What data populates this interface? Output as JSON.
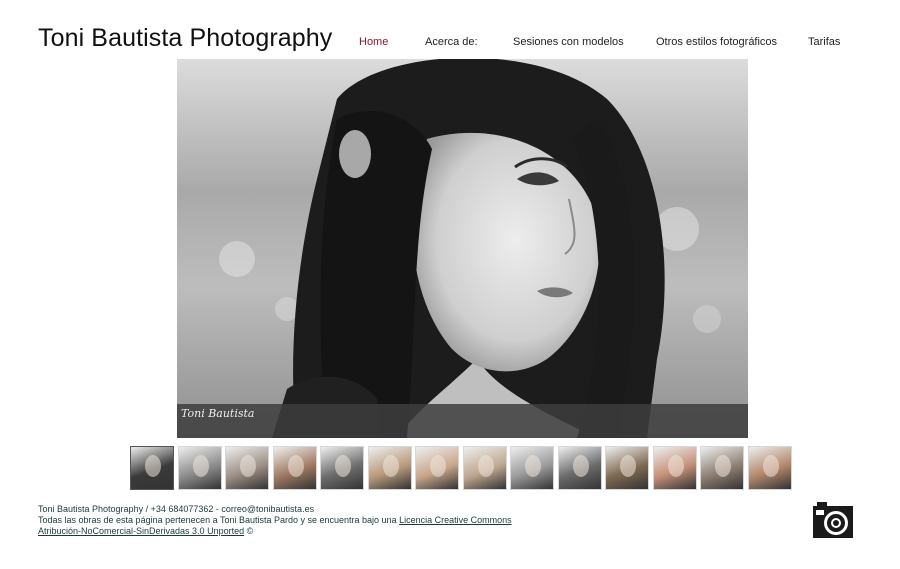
{
  "header": {
    "site_title": "Toni Bautista Photography",
    "nav": [
      {
        "label": "Home",
        "active": true
      },
      {
        "label": "Acerca de:",
        "active": false
      },
      {
        "label": "Sesiones con modelos",
        "active": false
      },
      {
        "label": "Otros estilos fotográficos",
        "active": false
      },
      {
        "label": "Tarifas",
        "active": false
      }
    ]
  },
  "slideshow": {
    "signature": "Toni Bautista"
  },
  "thumbnails": [
    {
      "tone": "#3a3a3a",
      "selected": true
    },
    {
      "tone": "#8c8c8c"
    },
    {
      "tone": "#9b8f86"
    },
    {
      "tone": "#a07a63"
    },
    {
      "tone": "#6d6d6d"
    },
    {
      "tone": "#b89a7c"
    },
    {
      "tone": "#c9a68c"
    },
    {
      "tone": "#bfa78f"
    },
    {
      "tone": "#9a9a9a"
    },
    {
      "tone": "#6a6a6a"
    },
    {
      "tone": "#7f6a52"
    },
    {
      "tone": "#c48f77"
    },
    {
      "tone": "#8e7f73"
    },
    {
      "tone": "#b2876b"
    }
  ],
  "footer": {
    "line1": "Toni Bautista Photography / +34 684077362 - correo@tonibautista.es",
    "line2_prefix": "Todas las obras de esta página pertenecen a Toni Bautista Pardo y se encuentra bajo una ",
    "license_link_1": "Licencia Creative Commons",
    "license_link_2": "Atribución-NoComercial-SinDerivadas 3.0 Unported",
    "line3_suffix": " ©"
  },
  "colors": {
    "nav_active": "#8a1530",
    "footer_text": "#1a3a3a"
  }
}
